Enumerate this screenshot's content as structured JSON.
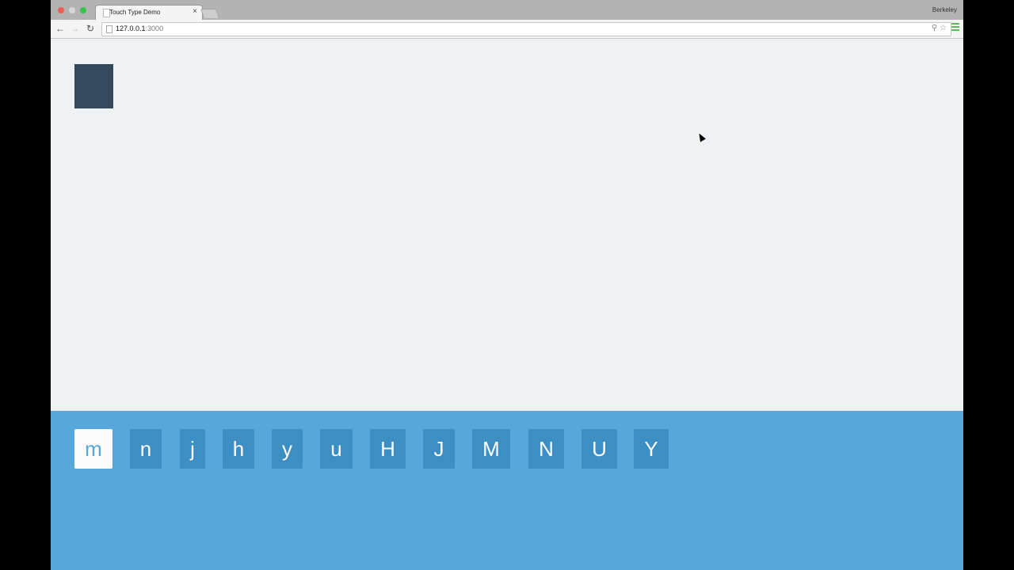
{
  "browser": {
    "tab_title": "Touch Type Demo",
    "tab_close": "×",
    "profile_name": "Berkeley",
    "url_host": "127.0.0.1",
    "url_port": ":3000",
    "icons": {
      "back": "back-arrow-icon",
      "forward": "forward-arrow-icon",
      "reload": "reload-icon",
      "search": "search-icon",
      "star": "bookmark-star-icon",
      "menu": "menu-icon"
    }
  },
  "colors": {
    "page_bg": "#eff2f2",
    "keyboard_bg": "#58a7db",
    "key_bg": "#3d8ec3",
    "key_active_bg": "#fbfbfb",
    "target_card": "#34495e"
  },
  "keyboard": {
    "active_key": "m",
    "keys": [
      "m",
      "n",
      "j",
      "h",
      "y",
      "u",
      "H",
      "J",
      "M",
      "N",
      "U",
      "Y"
    ]
  }
}
